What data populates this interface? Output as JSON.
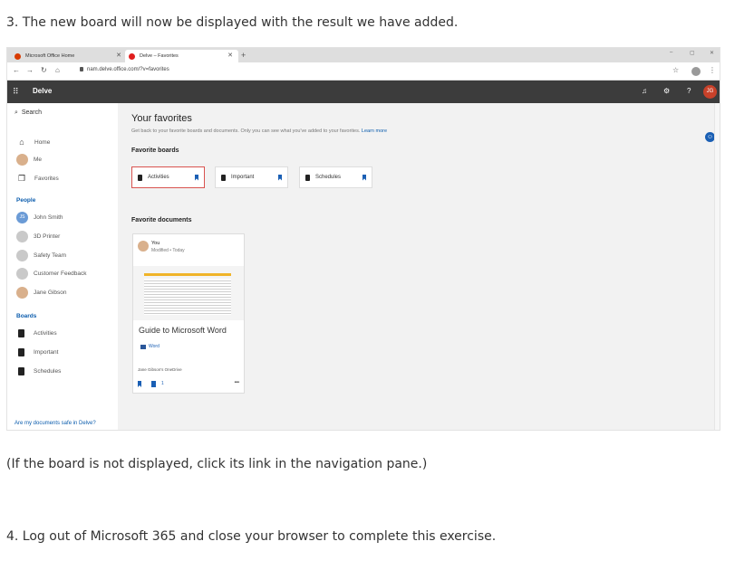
{
  "doc": {
    "step3": "3. The new board will now be displayed with the result we have added.",
    "note": "(If the board is not displayed, click its link in the navigation pane.)",
    "step4": "4. Log out of Microsoft 365 and close your browser to complete this exercise."
  },
  "browser": {
    "tabs": [
      {
        "label": "Microsoft Office Home",
        "favicon_color": "#d83b01"
      },
      {
        "label": "Delve – Favorites",
        "favicon_color": "#e01e1e"
      }
    ],
    "new_tab": "+",
    "url": "nam.delve.office.com/?v=favorites",
    "window_controls": [
      "–",
      "▢",
      "✕"
    ]
  },
  "app": {
    "name": "Delve",
    "avatar_initials": "JG",
    "avatar_color": "#c8412a"
  },
  "sidebar": {
    "search_label": "Search",
    "nav": [
      {
        "label": "Home",
        "icon": "home-icon"
      },
      {
        "label": "Me",
        "icon": "person-icon"
      },
      {
        "label": "Favorites",
        "icon": "bookmark-icon"
      }
    ],
    "people_header": "People",
    "people": [
      {
        "label": "John Smith",
        "initials": "JS"
      },
      {
        "label": "3D Printer"
      },
      {
        "label": "Safety Team"
      },
      {
        "label": "Customer Feedback"
      },
      {
        "label": "Jane Gibson"
      }
    ],
    "boards_header": "Boards",
    "boards": [
      "Activities",
      "Important",
      "Schedules"
    ],
    "safe_link": "Are my documents safe in Delve?"
  },
  "main": {
    "title": "Your favorites",
    "subtitle": "Get back to your favorite boards and documents. Only you can see what you've added to your favorites.",
    "learn_more": "Learn more",
    "fav_boards_title": "Favorite boards",
    "fav_boards": [
      "Activities",
      "Important",
      "Schedules"
    ],
    "fav_docs_title": "Favorite documents",
    "card": {
      "who": "You",
      "modified": "Modified • Today",
      "badge": "Word",
      "title": "Guide to Microsoft Word",
      "location": "Jane Gibson's OneDrive",
      "count": "1",
      "more": "•••"
    }
  }
}
